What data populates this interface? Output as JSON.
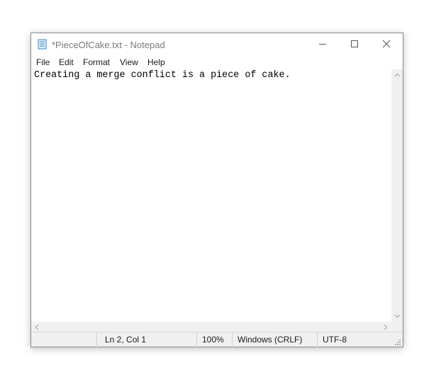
{
  "window": {
    "title": "*PieceOfCake.txt - Notepad",
    "controls": {
      "minimize_icon": "minimize-icon",
      "maximize_icon": "maximize-icon",
      "close_icon": "close-icon"
    }
  },
  "menu": {
    "items": [
      {
        "label": "File"
      },
      {
        "label": "Edit"
      },
      {
        "label": "Format"
      },
      {
        "label": "View"
      },
      {
        "label": "Help"
      }
    ]
  },
  "editor": {
    "text": "Creating a merge conflict is a piece of cake."
  },
  "status": {
    "position": "Ln 2, Col 1",
    "zoom": "100%",
    "line_ending": "Windows (CRLF)",
    "encoding": "UTF-8"
  },
  "colors": {
    "title_text": "#7a7a7a",
    "chrome": "#f0f0f0",
    "border": "#888888"
  }
}
